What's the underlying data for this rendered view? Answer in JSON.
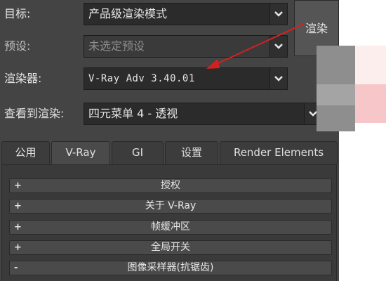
{
  "settings": {
    "target": {
      "label": "目标:",
      "value": "产品级渲染模式"
    },
    "preset": {
      "label": "预设:",
      "value": "未选定预设"
    },
    "renderer": {
      "label": "渲染器:",
      "value": "V-Ray Adv 3.40.01"
    },
    "view": {
      "label": "查看到渲染:",
      "value": "四元菜单 4 - 透视"
    }
  },
  "render_button": {
    "label": "渲染"
  },
  "tabs": [
    {
      "label": "公用"
    },
    {
      "label": "V-Ray",
      "active": true
    },
    {
      "label": "GI"
    },
    {
      "label": "设置"
    },
    {
      "label": "Render Elements"
    }
  ],
  "rollouts": [
    {
      "sign": "+",
      "title": "授权"
    },
    {
      "sign": "+",
      "title": "关于 V-Ray"
    },
    {
      "sign": "+",
      "title": "帧缓冲区"
    },
    {
      "sign": "+",
      "title": "全局开关"
    },
    {
      "sign": "-",
      "title": "图像采样器(抗锯齿)"
    }
  ],
  "colors": {
    "panel_bg": "#444444",
    "annotation_arrow": "#d62020",
    "pixel_blocks": [
      "#8a8a8a",
      "#a8a8a8",
      "#fdf0f0",
      "#f7c8ca"
    ]
  },
  "icons": {
    "dropdown": "chevron-down-icon",
    "annotation": "red-arrow-annotation"
  }
}
